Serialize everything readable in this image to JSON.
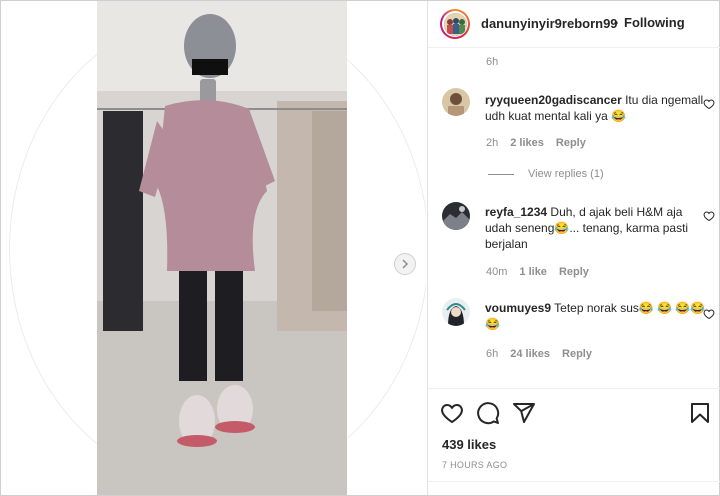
{
  "post": {
    "username": "danunyinyir9reborn99",
    "separator": "•",
    "follow_label": "Following",
    "likes_label": "439 likes",
    "time_ago": "7 HOURS AGO"
  },
  "top_time": "6h",
  "comments": [
    {
      "user": "ryyqueen20gadiscancer",
      "text": "Itu dia ngemall udh kuat mental kali ya 😂",
      "time": "2h",
      "likes": "2 likes",
      "reply": "Reply"
    },
    {
      "user": "reyfa_1234",
      "text": "Duh, d ajak beli H&M aja udah seneng😂... tenang, karma pasti berjalan",
      "time": "40m",
      "likes": "1 like",
      "reply": "Reply"
    },
    {
      "user": "voumuyes9",
      "text": "Tetep norak sus😂 😂 😂😂😂",
      "time": "6h",
      "likes": "24 likes",
      "reply": "Reply"
    }
  ],
  "view_replies": "View replies (1)",
  "icons": {
    "like": "heart-icon",
    "comment": "comment-icon",
    "share": "share-icon",
    "save": "bookmark-icon",
    "next": "chevron-right-icon"
  },
  "colors": {
    "text": "#262626",
    "muted": "#8e8e8e"
  }
}
